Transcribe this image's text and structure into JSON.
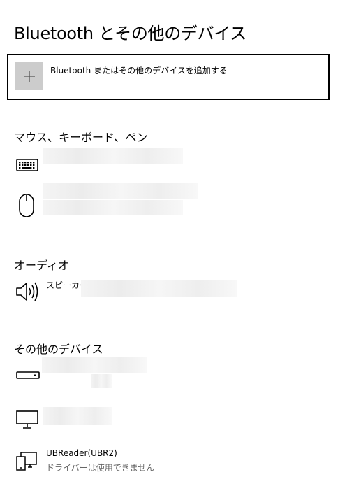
{
  "page": {
    "title": "Bluetooth とその他のデバイス"
  },
  "add_device": {
    "label": "Bluetooth またはその他のデバイスを追加する",
    "icon": "plus-icon"
  },
  "sections": {
    "input": {
      "title": "マウス、キーボード、ペン"
    },
    "audio": {
      "title": "オーディオ"
    },
    "other": {
      "title": "その他のデバイス"
    }
  },
  "devices": {
    "keyboard": {
      "icon": "keyboard-icon"
    },
    "mouse": {
      "icon": "mouse-icon"
    },
    "speaker": {
      "name": "スピーカー",
      "icon": "speaker-icon"
    },
    "drive": {
      "icon": "drive-icon"
    },
    "monitor": {
      "icon": "monitor-icon"
    },
    "ubreader": {
      "name": "UBReader(UBR2)",
      "status": "ドライバーは使用できません",
      "icon": "devices-icon"
    }
  }
}
